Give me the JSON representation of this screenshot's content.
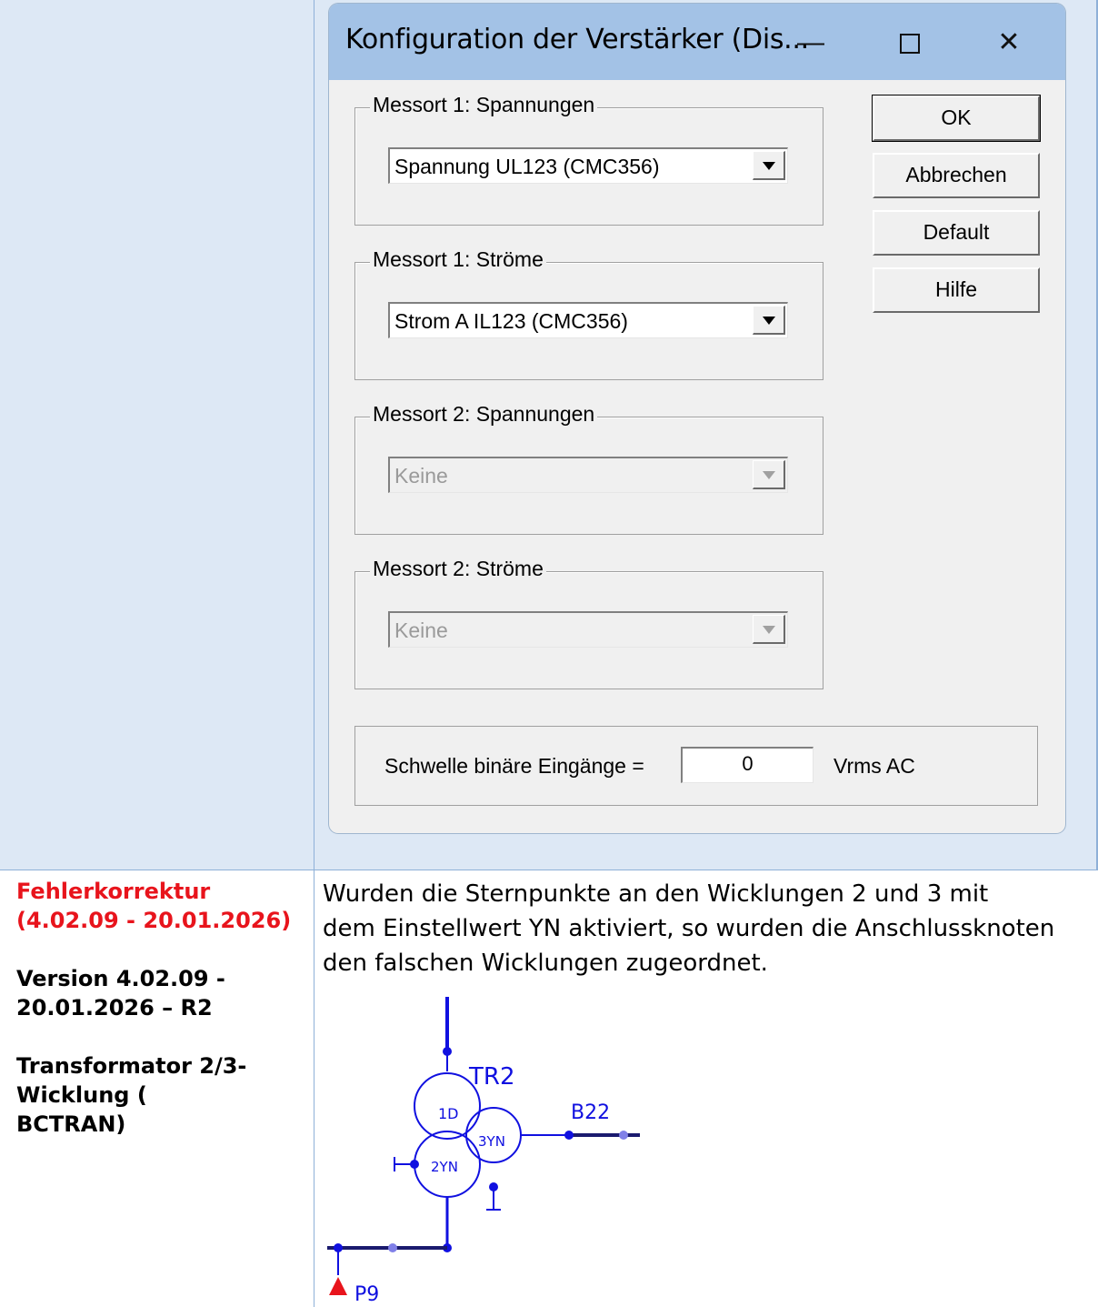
{
  "dialog": {
    "title": "Konfiguration der Verstärker (Dis...",
    "window_buttons": {
      "minimize": "—",
      "maximize": "☐",
      "close": "✕"
    },
    "groups": [
      {
        "label": "Messort 1: Spannungen",
        "selected": "Spannung UL123 (CMC356)",
        "enabled": true
      },
      {
        "label": "Messort 1: Ströme",
        "selected": "Strom A IL123 (CMC356)",
        "enabled": true
      },
      {
        "label": "Messort 2: Spannungen",
        "selected": "Keine",
        "enabled": false
      },
      {
        "label": "Messort 2: Ströme",
        "selected": "Keine",
        "enabled": false
      }
    ],
    "buttons": {
      "ok": "OK",
      "cancel": "Abbrechen",
      "default": "Default",
      "help": "Hilfe"
    },
    "threshold": {
      "label": "Schwelle binäre Eingänge =",
      "value": "0",
      "unit": "Vrms AC"
    }
  },
  "row2": {
    "left": {
      "heading_line1": "Fehlerkorrektur",
      "heading_line2": "(4.02.09 - 20.01.2026)",
      "version_line1": "Version 4.02.09 -",
      "version_line2": "20.01.2026 – R2",
      "topic_line1": "Transformator 2/3-",
      "topic_line2": "Wicklung (",
      "topic_line3": "BCTRAN)"
    },
    "description": {
      "line1": "Wurden die Sternpunkte an den Wicklungen 2 und 3 mit",
      "line2": "dem Einstellwert YN aktiviert, so wurden die Anschlussknoten",
      "line3": "den falschen Wicklungen zugeordnet."
    },
    "schematic": {
      "transformer_label": "TR2",
      "winding1": "1D",
      "winding2": "2YN",
      "winding3": "3YN",
      "bus_right": "B22",
      "bus_left": "P9",
      "colors": {
        "wire": "#1010e0",
        "bus": "#1a1a6e",
        "node_light": "#8080e8",
        "marker": "#e8141c"
      }
    }
  }
}
